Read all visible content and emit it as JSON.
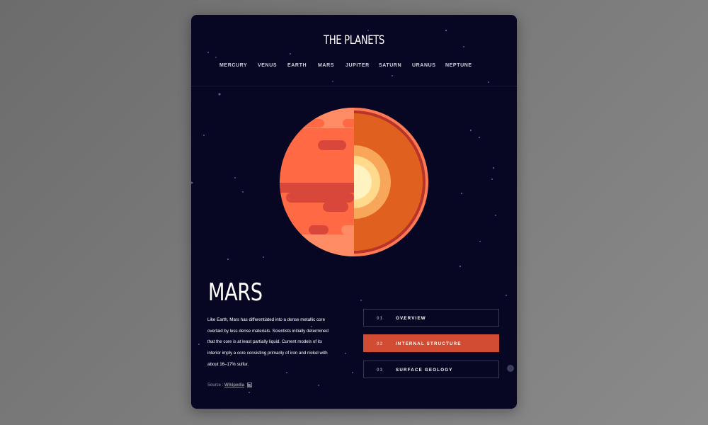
{
  "app": {
    "logo": "THE PLANETS"
  },
  "nav": {
    "items": [
      "MERCURY",
      "VENUS",
      "EARTH",
      "MARS",
      "JUPITER",
      "SATURN",
      "URANUS",
      "NEPTUNE"
    ]
  },
  "planet": {
    "name": "MARS",
    "description": "Like Earth, Mars has differentiated into a dense metallic core overlaid by less dense materials. Scientists initially determined that the core is at least partially liquid. Current models of its interior imply a core consisting primarily of iron and nickel with about 16–17% sulfur.",
    "source_label": "Source :",
    "source_link": "Wikipedia",
    "image_icon": "mars-internal-structure-icon"
  },
  "tabs": [
    {
      "num": "01",
      "label": "OVERVIEW",
      "active": false
    },
    {
      "num": "02",
      "label": "INTERNAL STRUCTURE",
      "active": true
    },
    {
      "num": "03",
      "label": "SURFACE GEOLOGY",
      "active": false
    }
  ],
  "colors": {
    "background": "#070724",
    "accent": "#d14c32",
    "mars_surface": "#ff6a45",
    "mars_core": "#fff3c1"
  }
}
